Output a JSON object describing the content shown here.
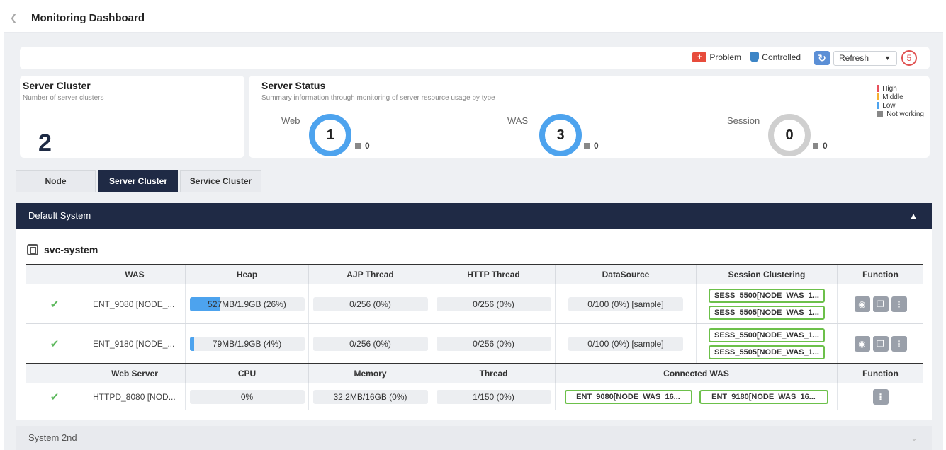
{
  "header": {
    "title": "Monitoring Dashboard"
  },
  "toolbar": {
    "problem_label": "Problem",
    "controlled_label": "Controlled",
    "refresh_label": "Refresh",
    "refresh_count": "5",
    "colors": {
      "problem": "#e74c3c",
      "controlled": "#3d85c6",
      "refresh": "#5b8fd6"
    }
  },
  "server_cluster": {
    "title": "Server Cluster",
    "subtitle": "Number of server clusters",
    "count": "2"
  },
  "server_status": {
    "title": "Server Status",
    "subtitle": "Summary information through monitoring of server resource usage by type",
    "web": {
      "label": "Web",
      "value": "1",
      "not_working": "0"
    },
    "was": {
      "label": "WAS",
      "value": "3",
      "not_working": "0"
    },
    "session": {
      "label": "Session",
      "value": "0",
      "not_working": "0"
    },
    "legend": {
      "high": "High",
      "middle": "Middle",
      "low": "Low",
      "not_working": "Not working"
    },
    "legend_colors": {
      "high": "#e8505b",
      "middle": "#f5b031",
      "low": "#4da3ee",
      "not_working": "#888888"
    }
  },
  "tabs": {
    "node": "Node",
    "server_cluster": "Server Cluster",
    "service_cluster": "Service Cluster"
  },
  "sections": {
    "default_system": "Default System",
    "system_2nd": "System 2nd"
  },
  "svc": {
    "name": "svc-system",
    "was_headers": {
      "col0": "",
      "was": "WAS",
      "heap": "Heap",
      "ajp": "AJP Thread",
      "http": "HTTP Thread",
      "ds": "DataSource",
      "session": "Session Clustering",
      "function": "Function"
    },
    "was_rows": [
      {
        "name": "ENT_9080 [NODE_...",
        "heap": "527MB/1.9GB (26%)",
        "heap_pct": 26,
        "ajp": "0/256 (0%)",
        "http": "0/256 (0%)",
        "ds": "0/100 (0%) [sample]",
        "sess1": "SESS_5500[NODE_WAS_1...",
        "sess2": "SESS_5505[NODE_WAS_1..."
      },
      {
        "name": "ENT_9180 [NODE_...",
        "heap": "79MB/1.9GB (4%)",
        "heap_pct": 4,
        "ajp": "0/256 (0%)",
        "http": "0/256 (0%)",
        "ds": "0/100 (0%) [sample]",
        "sess1": "SESS_5500[NODE_WAS_1...",
        "sess2": "SESS_5505[NODE_WAS_1..."
      }
    ],
    "web_headers": {
      "col0": "",
      "web": "Web Server",
      "cpu": "CPU",
      "mem": "Memory",
      "thread": "Thread",
      "conn": "Connected WAS",
      "function": "Function"
    },
    "web_rows": [
      {
        "name": "HTTPD_8080 [NOD...",
        "cpu": "0%",
        "mem": "32.2MB/16GB (0%)",
        "thread": "1/150 (0%)",
        "conn1": "ENT_9080[NODE_WAS_16...",
        "conn2": "ENT_9180[NODE_WAS_16..."
      }
    ]
  }
}
